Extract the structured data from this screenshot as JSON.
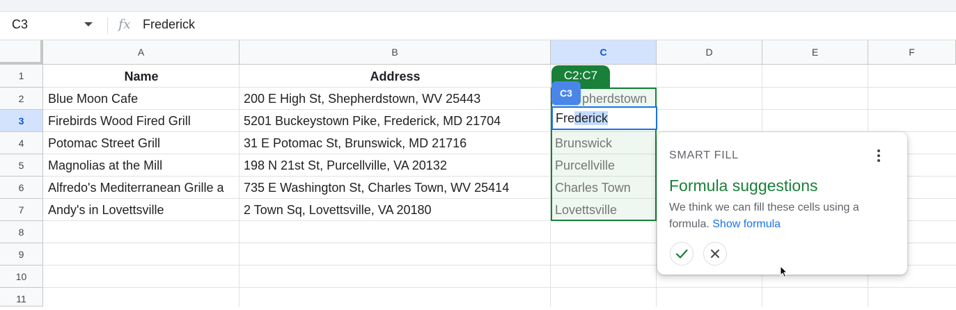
{
  "formula_bar": {
    "name_box": "C3",
    "fx_label": "fx",
    "value": "Frederick"
  },
  "columns": [
    "A",
    "B",
    "C",
    "D",
    "E",
    "F"
  ],
  "rows": [
    "1",
    "2",
    "3",
    "4",
    "5",
    "6",
    "7",
    "8",
    "9",
    "10",
    "11"
  ],
  "cells": {
    "A1": "Name",
    "B1": "Address",
    "A2": "Blue Moon Cafe",
    "B2": "200 E High St, Shepherdstown, WV 25443",
    "A3": "Firebirds Wood Fired Grill",
    "B3": "5201 Buckeystown Pike, Frederick, MD 21704",
    "A4": "Potomac Street Grill",
    "B4": "31 E Potomac St, Brunswick, MD 21716",
    "A5": "Magnolias at the Mill",
    "B5": "198 N 21st St, Purcellville, VA 20132",
    "A6": "Alfredo's Mediterranean Grille a",
    "B6": "735 E Washington St, Charles Town, WV 25414",
    "A7": "Andy's in Lovettsville",
    "B7": "2 Town Sq, Lovettsville, VA 20180",
    "C2": "pherdstown",
    "C4": "Brunswick",
    "C5": "Purcellville",
    "C6": "Charles Town",
    "C7": "Lovettsville"
  },
  "active_cell": {
    "label": "C3",
    "typed": "Fre",
    "autocomplete": "derick"
  },
  "range_tag": "C2:C7",
  "smart_fill": {
    "eyebrow": "SMART FILL",
    "title": "Formula suggestions",
    "description": "We think we can fill these cells using a formula.",
    "link": "Show formula",
    "accept_icon": "check-icon",
    "reject_icon": "close-icon"
  },
  "colors": {
    "green": "#188038",
    "blue": "#1a73e8",
    "selected_header": "#d3e3fd"
  }
}
